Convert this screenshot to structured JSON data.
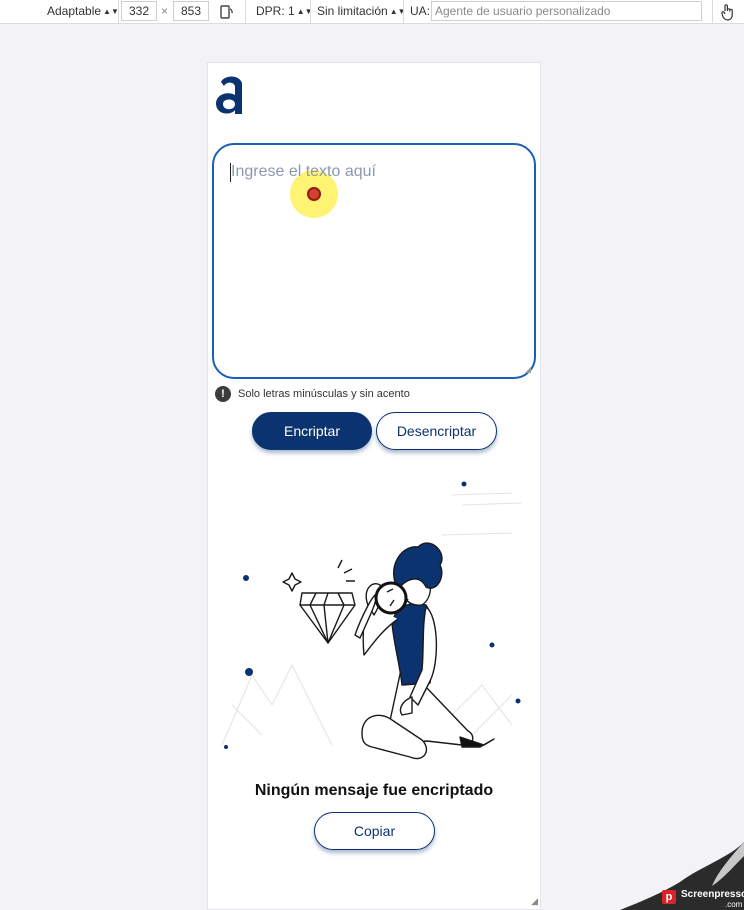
{
  "toolbar": {
    "dimensions_mode": "Adaptable",
    "width": "332",
    "times": "×",
    "height": "853",
    "dpr": "DPR: 1",
    "throttling": "Sin limitación",
    "ua_label": "UA:",
    "ua_placeholder": "Agente de usuario personalizado",
    "rotate_icon": "rotate-icon",
    "touch_icon": "touch-hand-icon"
  },
  "app": {
    "logo_icon": "alura-logo-icon",
    "input_placeholder": "Ingrese el texto aquí",
    "hint_icon": "!",
    "hint_text": "Solo letras minúsculas y sin acento",
    "encrypt_label": "Encriptar",
    "decrypt_label": "Desencriptar",
    "empty_message": "Ningún mensaje fue encriptado",
    "copy_label": "Copiar"
  },
  "colors": {
    "primary": "#0b3370",
    "textarea_border": "#1a5fb8",
    "placeholder": "#8b98b3"
  },
  "watermark": {
    "logo_letter": "p",
    "name": "Screenpresso",
    "domain": ".com"
  }
}
